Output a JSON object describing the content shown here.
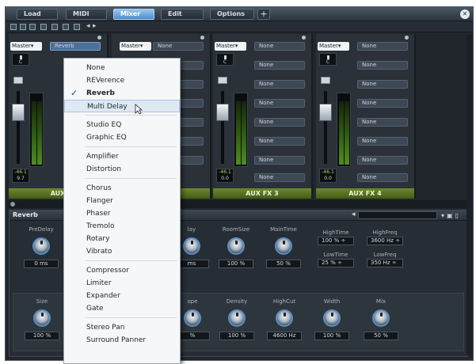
{
  "tabs": [
    {
      "label": "Load"
    },
    {
      "label": "MIDI"
    },
    {
      "label": "Mixer"
    },
    {
      "label": "Edit"
    },
    {
      "label": "Options"
    }
  ],
  "tab_plus": "+",
  "close_glyph": "✕",
  "strips": [
    {
      "name": "AUX",
      "master": "Master▾",
      "fx": [
        "Reverb",
        "",
        "",
        "",
        "",
        "",
        "",
        ""
      ],
      "pan": "C",
      "readout_top": "-46.1",
      "readout_bottom": "9.7"
    },
    {
      "name": "",
      "master": "Master▾",
      "fx": [
        "None",
        "",
        "",
        "",
        "",
        "",
        "",
        ""
      ],
      "pan": "",
      "readout_top": "",
      "readout_bottom": ""
    },
    {
      "name": "AUX FX 3",
      "master": "Master▾",
      "fx": [
        "None",
        "None",
        "None",
        "None",
        "None",
        "None",
        "None",
        "None"
      ],
      "pan": "C",
      "readout_top": "-46.1",
      "readout_bottom": "0.0"
    },
    {
      "name": "AUX FX 4",
      "master": "Master▾",
      "fx": [
        "None",
        "None",
        "None",
        "None",
        "None",
        "None",
        "None",
        "None"
      ],
      "pan": "C",
      "readout_top": "-46.1",
      "readout_bottom": "0.0"
    }
  ],
  "fx_panel": {
    "title": "Reverb",
    "row1_knobs": [
      {
        "label": "PreDelay",
        "value": "0 ms"
      },
      {
        "label": "lay",
        "value": "ms"
      },
      {
        "label": "RoomSize",
        "value": "100 %"
      },
      {
        "label": "MainTime",
        "value": "50 %"
      }
    ],
    "row1_spins": [
      {
        "label": "HighTime",
        "value": "100 % ÷"
      },
      {
        "label": "HighFreq",
        "value": "3600 Hz ÷"
      },
      {
        "label": "LowTime",
        "value": "25 % ÷"
      },
      {
        "label": "LowFreq",
        "value": "350 Hz ÷"
      }
    ],
    "row2_knobs": [
      {
        "label": "Size",
        "value": "100 %"
      },
      {
        "label": "ope",
        "value": "%"
      },
      {
        "label": "Density",
        "value": "100 %"
      },
      {
        "label": "HighCut",
        "value": "4600 Hz"
      },
      {
        "label": "Width",
        "value": "100 %"
      },
      {
        "label": "Mix",
        "value": "50 %"
      }
    ]
  },
  "menu": {
    "items": [
      {
        "label": "None",
        "bold": false,
        "checked": false,
        "hover": false
      },
      {
        "label": "REVerence",
        "bold": false,
        "checked": false,
        "hover": false
      },
      {
        "label": "Reverb",
        "bold": true,
        "checked": true,
        "hover": false
      },
      {
        "label": "Multi Delay",
        "bold": false,
        "checked": false,
        "hover": true
      },
      {
        "label": "Studio EQ",
        "bold": false,
        "checked": false,
        "hover": false
      },
      {
        "label": "Graphic EQ",
        "bold": false,
        "checked": false,
        "hover": false
      },
      {
        "label": "Amplifier",
        "bold": false,
        "checked": false,
        "hover": false
      },
      {
        "label": "Distortion",
        "bold": false,
        "checked": false,
        "hover": false
      },
      {
        "label": "Chorus",
        "bold": false,
        "checked": false,
        "hover": false
      },
      {
        "label": "Flanger",
        "bold": false,
        "checked": false,
        "hover": false
      },
      {
        "label": "Phaser",
        "bold": false,
        "checked": false,
        "hover": false
      },
      {
        "label": "Tremolo",
        "bold": false,
        "checked": false,
        "hover": false
      },
      {
        "label": "Rotary",
        "bold": false,
        "checked": false,
        "hover": false
      },
      {
        "label": "Vibrato",
        "bold": false,
        "checked": false,
        "hover": false
      },
      {
        "label": "Compressor",
        "bold": false,
        "checked": false,
        "hover": false
      },
      {
        "label": "Limiter",
        "bold": false,
        "checked": false,
        "hover": false
      },
      {
        "label": "Expander",
        "bold": false,
        "checked": false,
        "hover": false
      },
      {
        "label": "Gate",
        "bold": false,
        "checked": false,
        "hover": false
      },
      {
        "label": "Stereo Pan",
        "bold": false,
        "checked": false,
        "hover": false
      },
      {
        "label": "Surround Panner",
        "bold": false,
        "checked": false,
        "hover": false
      }
    ],
    "check_glyph": "✓"
  },
  "colors": {
    "accent": "#4d8ccc",
    "strip_name_bg": "#6c8a2e",
    "meter_green": "#4f8e1f"
  }
}
